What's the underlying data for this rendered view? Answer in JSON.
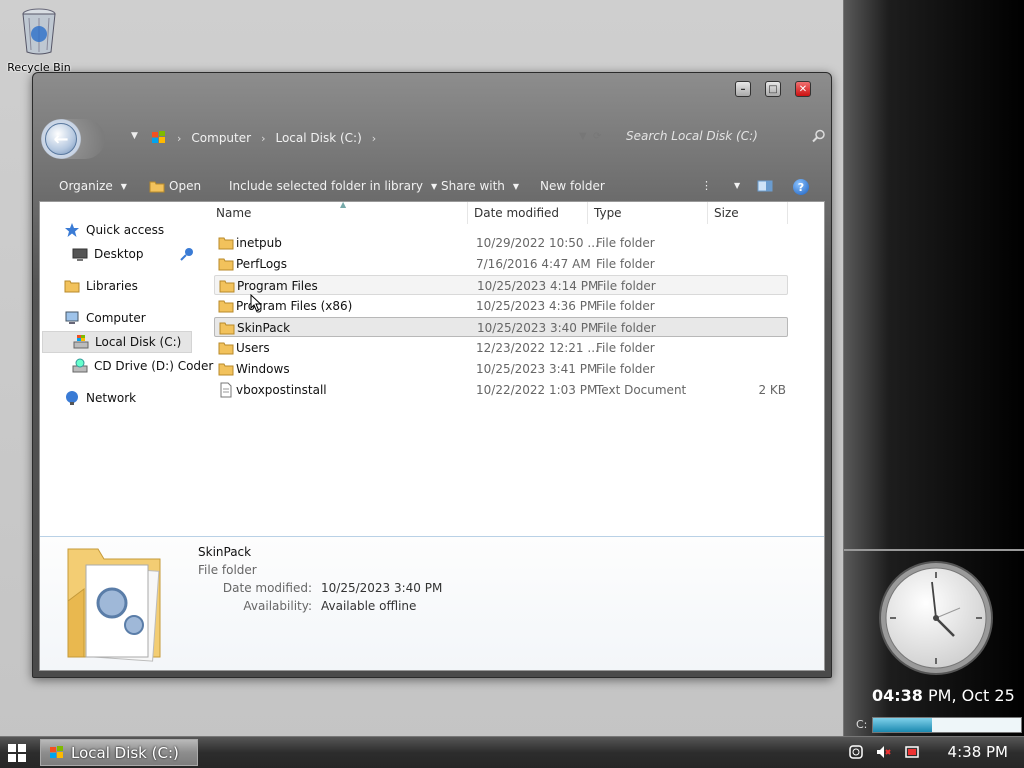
{
  "desktop": {
    "recycle_bin_label": "Recycle Bin"
  },
  "window": {
    "breadcrumb": [
      "Computer",
      "Local Disk (C:)"
    ],
    "search_placeholder": "Search Local Disk (C:)",
    "toolbar": {
      "organize": "Organize",
      "open": "Open",
      "include_library": "Include selected folder in library",
      "share_with": "Share with",
      "new_folder": "New folder"
    },
    "nav": {
      "quick_access": "Quick access",
      "desktop": "Desktop",
      "libraries": "Libraries",
      "computer": "Computer",
      "local_disk": "Local Disk (C:)",
      "cd_drive": "CD Drive (D:) Coder",
      "network": "Network"
    },
    "columns": {
      "name": "Name",
      "date": "Date modified",
      "type": "Type",
      "size": "Size"
    },
    "files": [
      {
        "name": "inetpub",
        "date": "10/29/2022 10:50 ...",
        "type": "File folder",
        "size": ""
      },
      {
        "name": "PerfLogs",
        "date": "7/16/2016 4:47 AM",
        "type": "File folder",
        "size": ""
      },
      {
        "name": "Program Files",
        "date": "10/25/2023 4:14 PM",
        "type": "File folder",
        "size": ""
      },
      {
        "name": "Program Files (x86)",
        "date": "10/25/2023 4:36 PM",
        "type": "File folder",
        "size": ""
      },
      {
        "name": "SkinPack",
        "date": "10/25/2023 3:40 PM",
        "type": "File folder",
        "size": ""
      },
      {
        "name": "Users",
        "date": "12/23/2022 12:21 ...",
        "type": "File folder",
        "size": ""
      },
      {
        "name": "Windows",
        "date": "10/25/2023 3:41 PM",
        "type": "File folder",
        "size": ""
      },
      {
        "name": "vboxpostinstall",
        "date": "10/22/2022 1:03 PM",
        "type": "Text Document",
        "size": "2 KB"
      }
    ],
    "details": {
      "name": "SkinPack",
      "type": "File folder",
      "date_modified_label": "Date modified:",
      "date_modified": "10/25/2023 3:40 PM",
      "availability_label": "Availability:",
      "availability": "Available offline"
    }
  },
  "gadgets": {
    "clock_time": "04:38",
    "clock_suffix": " PM, Oct 25",
    "drive_label": "C:",
    "drive_usage_fraction": 0.4
  },
  "taskbar": {
    "task_label": "Local Disk (C:)",
    "time": "4:38 PM"
  },
  "colors": {
    "accent": "#1a5fbf",
    "selection": "#e8e8e8",
    "close": "#cc1111"
  }
}
